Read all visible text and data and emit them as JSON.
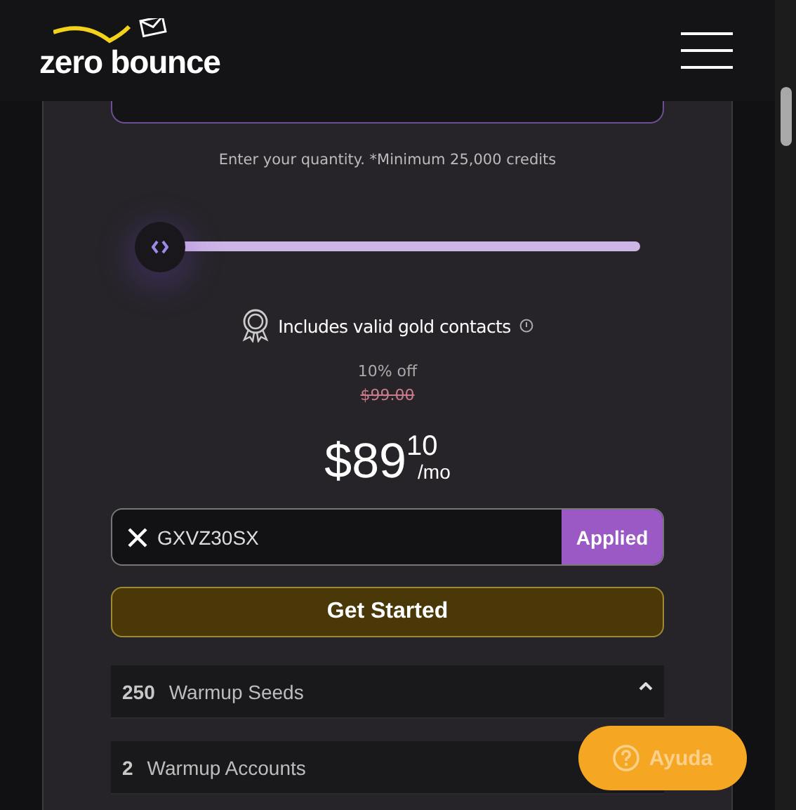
{
  "header": {
    "logo": "zero bounce"
  },
  "pricing": {
    "quantity_hint": "Enter your quantity. *Minimum 25,000 credits",
    "slider": {
      "level": 0
    },
    "feature": "Includes valid gold contacts",
    "discount": "10% off",
    "old_price": "$99.00",
    "price": {
      "whole": "$89",
      "cents": "10",
      "period": "/mo"
    },
    "coupon": {
      "value": "GXVZ30SX",
      "button": "Applied"
    },
    "cta": "Get Started",
    "addons": [
      {
        "count": "250",
        "label": "Warmup Seeds"
      },
      {
        "count": "2",
        "label": "Warmup Accounts"
      }
    ]
  },
  "help_button": "Ayuda"
}
